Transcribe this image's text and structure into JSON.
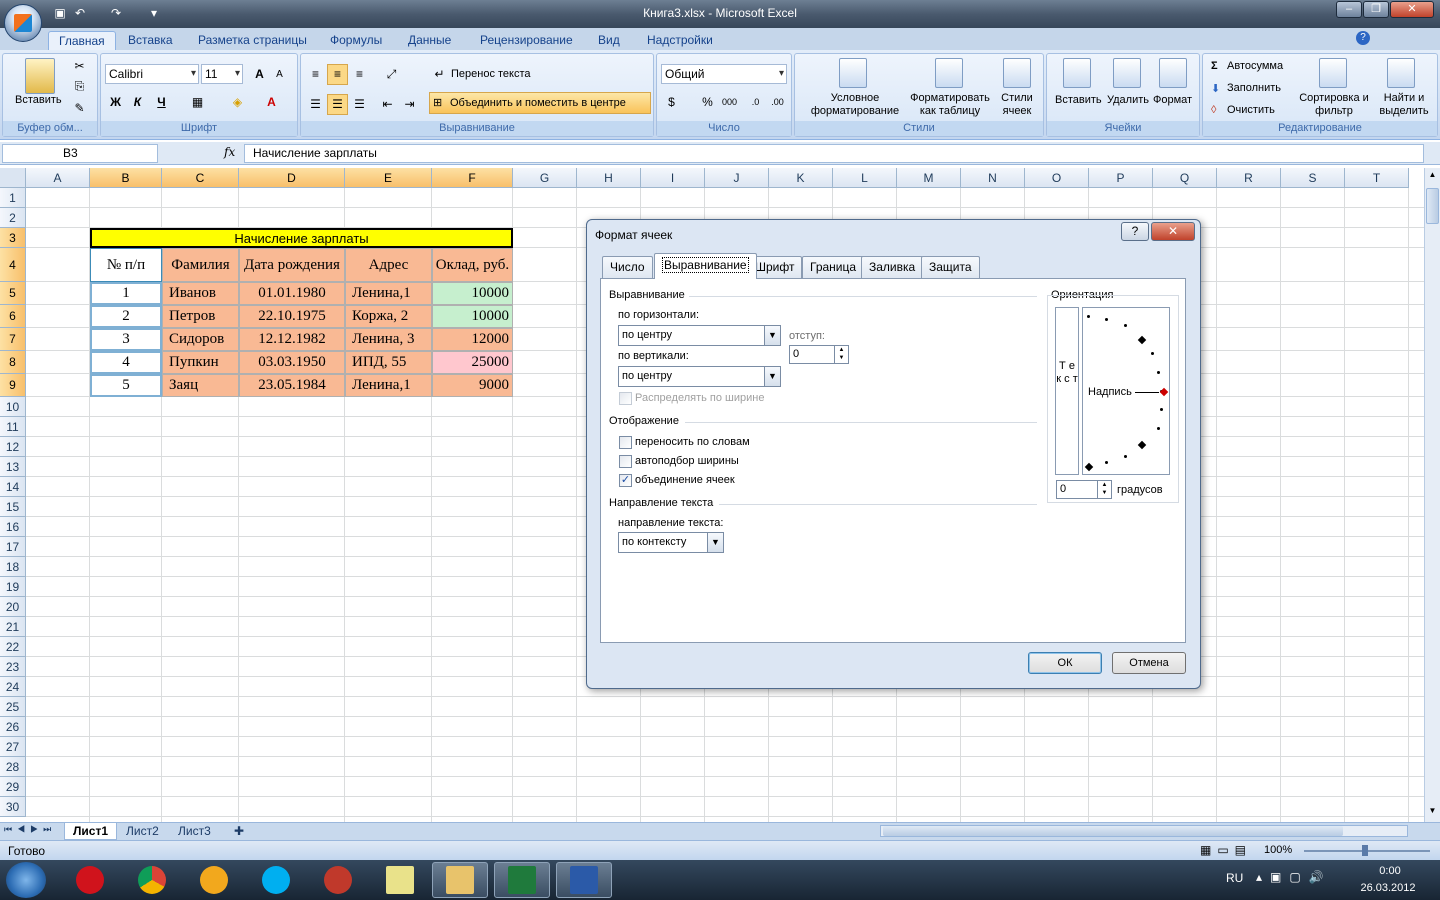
{
  "window": {
    "title": "Книга3.xlsx - Microsoft Excel"
  },
  "ribbon_tabs": [
    "Главная",
    "Вставка",
    "Разметка страницы",
    "Формулы",
    "Данные",
    "Рецензирование",
    "Вид",
    "Надстройки"
  ],
  "ribbon": {
    "clipboard": {
      "paste": "Вставить",
      "label": "Буфер обм..."
    },
    "font": {
      "name": "Calibri",
      "size": "11",
      "bold": "Ж",
      "italic": "К",
      "underline": "Ч",
      "grow": "A",
      "shrink": "A",
      "label": "Шрифт"
    },
    "alignment": {
      "wrap": "Перенос текста",
      "merge": "Объединить и поместить в центре",
      "label": "Выравнивание"
    },
    "number": {
      "format": "Общий",
      "percent": "%",
      "thousands": "000",
      "label": "Число"
    },
    "styles": {
      "cond_format": "Условное форматирование",
      "as_table": "Форматировать как таблицу",
      "cell_styles": "Стили ячеек",
      "label": "Стили"
    },
    "cells": {
      "insert": "Вставить",
      "delete": "Удалить",
      "format": "Формат",
      "label": "Ячейки"
    },
    "editing": {
      "autosum": "Автосумма",
      "fill": "Заполнить",
      "clear": "Очистить",
      "sort": "Сортировка и фильтр",
      "find": "Найти и выделить",
      "label": "Редактирование"
    }
  },
  "formula_bar": {
    "name_box": "B3",
    "fx": "fx",
    "formula": "Начисление зарплаты"
  },
  "columns": [
    "A",
    "B",
    "C",
    "D",
    "E",
    "F",
    "G",
    "H",
    "I",
    "J",
    "K",
    "L",
    "M",
    "N",
    "O",
    "P",
    "Q",
    "R",
    "S",
    "T"
  ],
  "rows": [
    "1",
    "2",
    "3",
    "4",
    "5",
    "6",
    "7",
    "8",
    "9",
    "10",
    "11",
    "12",
    "13",
    "14",
    "15",
    "16",
    "17",
    "18",
    "19",
    "20",
    "21",
    "22",
    "23",
    "24",
    "25",
    "26",
    "27",
    "28",
    "29",
    "30"
  ],
  "table": {
    "title": "Начисление зарплаты",
    "headers": [
      "№ п/п",
      "Фамилия",
      "Дата рождения",
      "Адрес",
      "Оклад, руб."
    ],
    "rows": [
      [
        "1",
        "Иванов",
        "01.01.1980",
        "Ленина,1",
        "10000"
      ],
      [
        "2",
        "Петров",
        "22.10.1975",
        "Коржа, 2",
        "10000"
      ],
      [
        "3",
        "Сидоров",
        "12.12.1982",
        "Ленина, 3",
        "12000"
      ],
      [
        "4",
        "Пупкин",
        "03.03.1950",
        "ИПД, 55",
        "25000"
      ],
      [
        "5",
        "Заяц",
        "23.05.1984",
        "Ленина,1",
        "9000"
      ]
    ],
    "colors": {
      "title": "#ffff00",
      "orange": "#f9b994",
      "green": "#c6efce",
      "pink": "#ffc7ce"
    }
  },
  "sheets": [
    "Лист1",
    "Лист2",
    "Лист3"
  ],
  "status": {
    "ready": "Готово",
    "zoom": "100%"
  },
  "taskbar": {
    "lang": "RU",
    "time": "0:00",
    "date": "26.03.2012"
  },
  "dialog": {
    "title": "Формат ячеек",
    "help": "?",
    "close": "✕",
    "tabs": [
      "Число",
      "Выравнивание",
      "Шрифт",
      "Граница",
      "Заливка",
      "Защита"
    ],
    "alignment_section": "Выравнивание",
    "horizontal_label": "по горизонтали:",
    "horizontal_value": "по центру",
    "indent_label": "отступ:",
    "indent_value": "0",
    "vertical_label": "по вертикали:",
    "vertical_value": "по центру",
    "distribute_label": "Распределять по ширине",
    "display_section": "Отображение",
    "wrap_label": "переносить по словам",
    "shrink_label": "автоподбор ширины",
    "merge_label": "объединение ячеек",
    "direction_section": "Направление текста",
    "direction_label": "направление текста:",
    "direction_value": "по контексту",
    "orientation_section": "Ориентация",
    "vertical_text": "Т е к с т",
    "inscription": "Надпись",
    "degrees_value": "0",
    "degrees_label": "градусов",
    "ok": "ОК",
    "cancel": "Отмена"
  }
}
